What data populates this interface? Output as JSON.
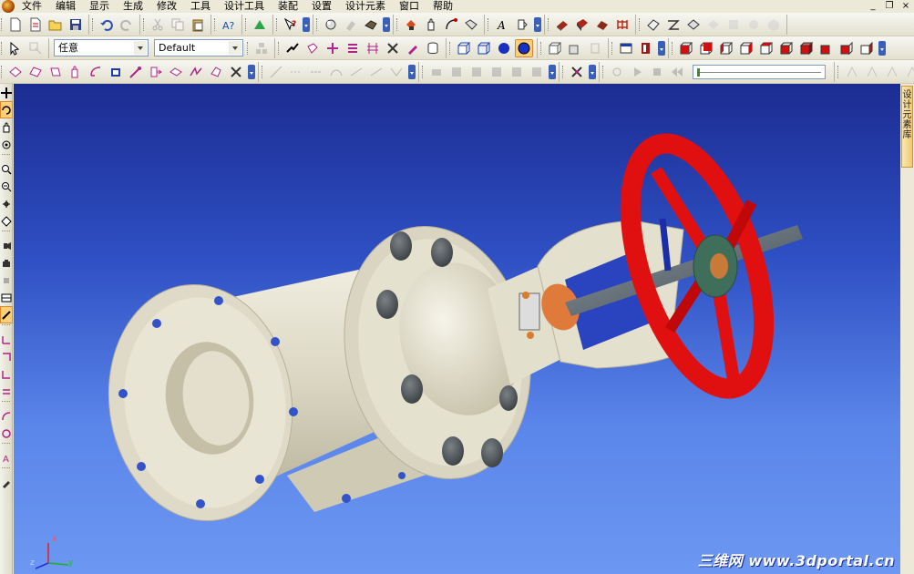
{
  "menubar": {
    "items": [
      "文件",
      "编辑",
      "显示",
      "生成",
      "修改",
      "工具",
      "设计工具",
      "装配",
      "设置",
      "设计元素",
      "窗口",
      "帮助"
    ],
    "window_controls": [
      "_",
      "❐",
      "×"
    ]
  },
  "toolbar2": {
    "filter_value": "任意",
    "style_value": "Default"
  },
  "right_panel": {
    "tab_label": "设计元素库"
  },
  "axis": {
    "x_label": "x",
    "y_label": "y",
    "z_label": "z"
  },
  "watermark": {
    "text": "三维网 www.3dportal.cn"
  },
  "colors": {
    "viewport_top": "#1c2c92",
    "viewport_bottom": "#6c97f2",
    "valve_body": "#e6e2cf",
    "handwheel": "#e01010",
    "bolts": "#4f5558",
    "nut": "#3f6e5a",
    "yoke_bushing": "#e07a3a",
    "axis_x": "#e02020",
    "axis_y": "#20b020",
    "axis_z": "#2030e0"
  },
  "icons": {
    "toolbar1": [
      "new-icon",
      "new-scene-icon",
      "open-icon",
      "save-icon",
      "undo-icon",
      "redo-icon",
      "cut-icon",
      "copy-icon",
      "paste-icon",
      "find-icon",
      "settings-icon",
      "help-icon",
      "render-icon",
      "paint-icon",
      "camera-icon",
      "print-icon",
      "hand-icon",
      "rotate-icon",
      "zoom-icon",
      "text-icon",
      "measure-icon",
      "light-icon",
      "material-icon",
      "box-shape-icon",
      "wire-icon"
    ],
    "toolbar2": [
      "select-icon",
      "pick-icon",
      "assembly-icon",
      "shape-icon",
      "triad-icon",
      "snap-icon",
      "align-icon",
      "grid-icon",
      "cube-icon",
      "sphere-icon",
      "solid-view-icon",
      "shaded-view-icon",
      "wireframe-icon",
      "view-front-icon",
      "view-back-icon",
      "view-left-icon",
      "view-right-icon",
      "view-top-icon",
      "view-bottom-icon",
      "view-iso-icon"
    ],
    "toolbar3": [
      "sketch-icon",
      "extrude-icon",
      "revolve-icon",
      "sweep-icon",
      "loft-icon",
      "fillet-icon",
      "chamfer-icon",
      "shell-icon",
      "pattern-icon",
      "mirror-icon",
      "boolean-icon",
      "line-icon",
      "arc-icon",
      "play-icon",
      "stop-icon",
      "rewind-icon"
    ],
    "left": [
      "pointer-icon",
      "rotate-view-icon",
      "pan-view-icon",
      "orbit-icon",
      "zoom-in-icon",
      "zoom-out-icon",
      "zoom-window-icon",
      "zoom-fit-icon",
      "light-icon",
      "camera-icon",
      "fly-icon",
      "section-icon",
      "measure-icon",
      "coordinate-icon",
      "trim-icon",
      "extend-icon",
      "offset-icon",
      "arc-tool-icon",
      "circle-tool-icon",
      "text-tool-icon",
      "eyedropper-icon"
    ]
  }
}
